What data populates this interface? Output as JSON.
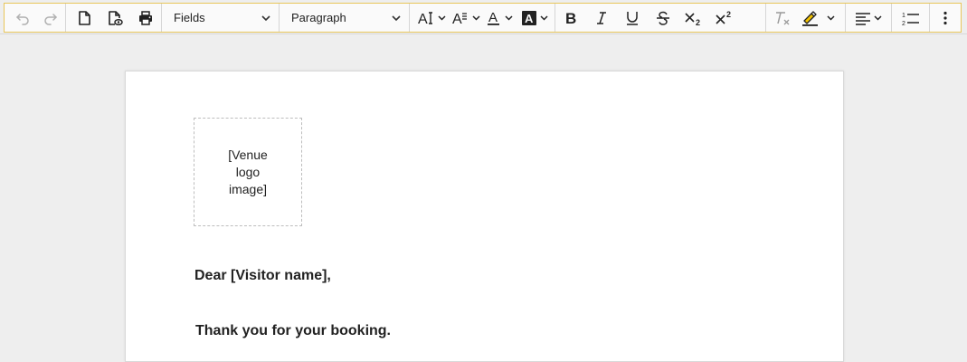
{
  "toolbar": {
    "history": {
      "undo_icon": "undo-icon",
      "redo_icon": "redo-icon"
    },
    "document": {
      "new_icon": "new-document-icon",
      "preview_icon": "preview-icon",
      "print_icon": "print-icon"
    },
    "fields_dropdown": {
      "label": "Fields"
    },
    "paragraph_dropdown": {
      "label": "Paragraph"
    },
    "formatting": {
      "font_size_icon": "font-size-icon",
      "line_height_icon": "line-height-icon",
      "font_color_icon": "font-color-icon",
      "background_color_icon": "background-color-icon",
      "bold_icon": "bold-icon",
      "italic_icon": "italic-icon",
      "underline_icon": "underline-icon",
      "strikethrough_icon": "strikethrough-icon",
      "subscript_icon": "subscript-icon",
      "superscript_icon": "superscript-icon"
    },
    "misc": {
      "clear_format_icon": "clear-formatting-icon",
      "highlight_icon": "highlight-icon",
      "align_icon": "align-left-icon",
      "ordered_list_icon": "ordered-list-icon",
      "more_icon": "more-vertical-icon"
    },
    "accent_border": "#e8c65a"
  },
  "document": {
    "logo_placeholder": "[Venue\nlogo\nimage]",
    "greeting": "Dear [Visitor name],",
    "body_line_1": "Thank you for your booking."
  }
}
